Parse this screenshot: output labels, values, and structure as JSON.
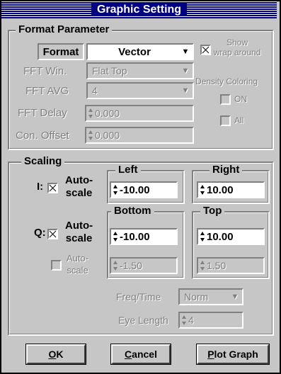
{
  "dialog": {
    "title": "Graphic Setting"
  },
  "format_parameter": {
    "legend": "Format Parameter",
    "format_label": "Format",
    "format_value": "Vector",
    "show_wrap_label_line1": "Show",
    "show_wrap_label_line2": "wrap around",
    "show_wrap_checked": true,
    "fft_win_label": "FFT Win.",
    "fft_win_value": "Flat Top",
    "fft_avg_label": "FFT AVG",
    "fft_avg_value": "4",
    "density_label": "Density Coloring",
    "density_on_label": "ON",
    "density_all_label": "All",
    "fft_delay_label": "FFT Delay",
    "fft_delay_value": "0.000",
    "con_offset_label": "Con. Offset",
    "con_offset_value": "0.000"
  },
  "scaling": {
    "legend": "Scaling",
    "i_label": "I:",
    "i_autoscale_line1": "Auto-",
    "i_autoscale_line2": "scale",
    "left_legend": "Left",
    "left_value": "-10.00",
    "right_legend": "Right",
    "right_value": "10.00",
    "q_label": "Q:",
    "q_autoscale_line1": "Auto-",
    "q_autoscale_line2": "scale",
    "bottom_legend": "Bottom",
    "bottom_value": "-10.00",
    "top_legend": "Top",
    "top_value": "10.00",
    "aux_autoscale_line1": "Auto-",
    "aux_autoscale_line2": "scale",
    "aux_bottom_value": "-1.50",
    "aux_top_value": "1.50",
    "freq_time_label": "Freq/Time",
    "freq_time_value": "Norm",
    "eye_length_label": "Eye Length",
    "eye_length_value": "4"
  },
  "buttons": {
    "ok_mnemonic": "O",
    "ok_rest": "K",
    "cancel_mnemonic": "C",
    "cancel_rest": "ancel",
    "plot_mnemonic": "P",
    "plot_rest": "lot Graph"
  }
}
